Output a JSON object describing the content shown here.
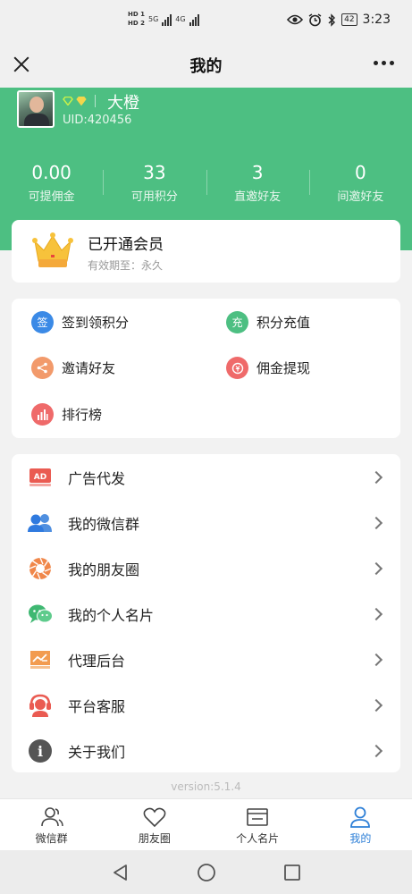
{
  "status_bar": {
    "hd_labels": [
      "HD 1",
      "HD 2"
    ],
    "net1": "5G",
    "net2": "4G",
    "battery": "42",
    "time": "3:23"
  },
  "header": {
    "title": "我的"
  },
  "profile": {
    "nickname": "大橙",
    "uid": "UID:420456",
    "badge_colors": [
      "#c7f04a",
      "#f3d64c"
    ]
  },
  "stats": [
    {
      "value": "0.00",
      "label": "可提佣金"
    },
    {
      "value": "33",
      "label": "可用积分"
    },
    {
      "value": "3",
      "label": "直邀好友"
    },
    {
      "value": "0",
      "label": "间邀好友"
    }
  ],
  "vip": {
    "title": "已开通会员",
    "subtitle": "有效期至：永久"
  },
  "features": [
    {
      "label": "签到领积分",
      "icon": "sign-in-icon",
      "glyph": "签",
      "color": "#3b8ae6"
    },
    {
      "label": "积分充值",
      "icon": "recharge-icon",
      "glyph": "充",
      "color": "#4dbf82"
    },
    {
      "label": "邀请好友",
      "icon": "share-icon",
      "glyph": "",
      "color": "#f29a6b"
    },
    {
      "label": "佣金提现",
      "icon": "withdraw-icon",
      "glyph": "",
      "color": "#ef6a6a"
    },
    {
      "label": "排行榜",
      "icon": "ranking-icon",
      "glyph": "",
      "color": "#ef6a6a"
    }
  ],
  "menu": [
    {
      "label": "广告代发",
      "icon": "ad-icon",
      "badge": "AD"
    },
    {
      "label": "我的微信群",
      "icon": "wechat-group-icon"
    },
    {
      "label": "我的朋友圈",
      "icon": "moments-icon"
    },
    {
      "label": "我的个人名片",
      "icon": "wechat-card-icon"
    },
    {
      "label": "代理后台",
      "icon": "agent-dashboard-icon"
    },
    {
      "label": "平台客服",
      "icon": "customer-service-icon"
    },
    {
      "label": "关于我们",
      "icon": "about-icon",
      "glyph": "i"
    }
  ],
  "version": "version:5.1.4",
  "tabs": [
    {
      "label": "微信群",
      "icon": "group-tab-icon",
      "active": false
    },
    {
      "label": "朋友圈",
      "icon": "heart-tab-icon",
      "active": false
    },
    {
      "label": "个人名片",
      "icon": "card-tab-icon",
      "active": false
    },
    {
      "label": "我的",
      "icon": "user-tab-icon",
      "active": true
    }
  ],
  "colors": {
    "brand_green": "#4dbf82",
    "active_tab": "#2f80d7"
  }
}
